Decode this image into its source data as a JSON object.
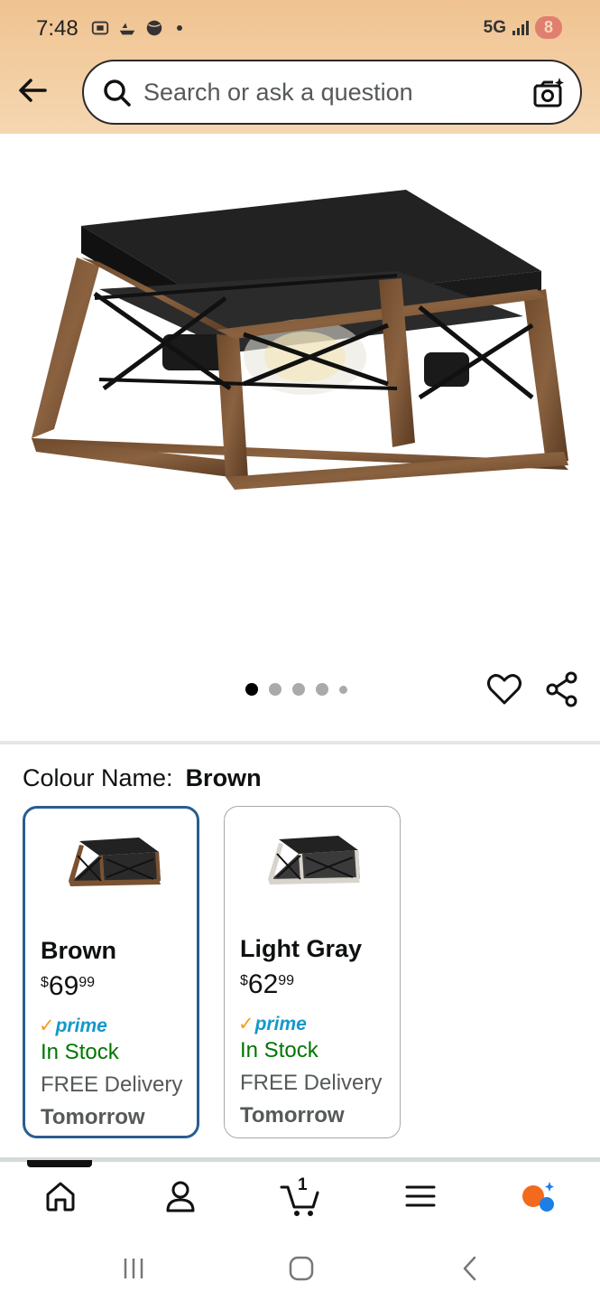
{
  "status_bar": {
    "time": "7:48",
    "network": "5G",
    "battery": "8"
  },
  "search": {
    "placeholder": "Search or ask a question"
  },
  "product": {
    "image_dots": 5,
    "active_dot": 0
  },
  "variation": {
    "label": "Colour Name:",
    "selected": "Brown",
    "options": [
      {
        "name": "Brown",
        "price_currency": "$",
        "price_whole": "69",
        "price_fraction": "99",
        "prime": "prime",
        "stock": "In Stock",
        "delivery": "FREE Delivery",
        "delivery_when": "Tomorrow",
        "selected": true
      },
      {
        "name": "Light Gray",
        "price_currency": "$",
        "price_whole": "62",
        "price_fraction": "99",
        "prime": "prime",
        "stock": "In Stock",
        "delivery": "FREE Delivery",
        "delivery_when": "Tomorrow",
        "selected": false
      }
    ]
  },
  "bottom_nav": {
    "items": [
      "home-icon",
      "account-icon",
      "cart-icon",
      "menu-icon",
      "rufus-icon"
    ],
    "cart_count": "1"
  },
  "colors": {
    "accent_selected": "#2a5d8f",
    "in_stock": "#007600",
    "prime_blue": "#1399c9",
    "prime_check": "#f39c21",
    "header_bg": "#f0c391"
  }
}
